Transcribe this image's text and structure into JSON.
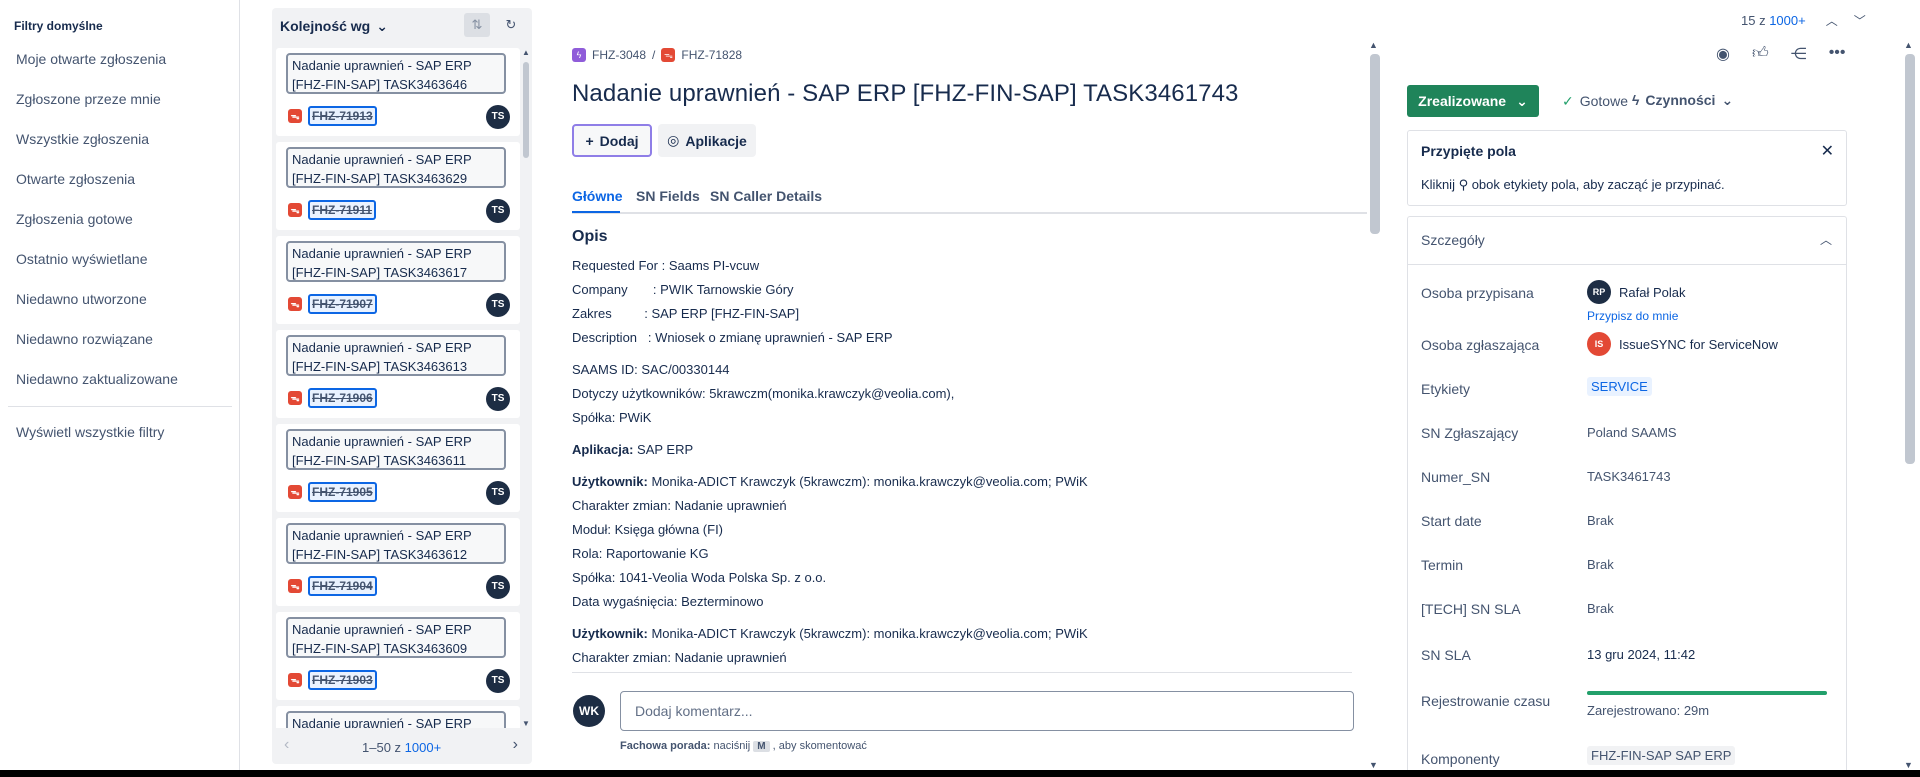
{
  "sidebar": {
    "heading": "Filtry domyślne",
    "items": [
      "Moje otwarte zgłoszenia",
      "Zgłoszone przeze mnie",
      "Wszystkie zgłoszenia",
      "Otwarte zgłoszenia",
      "Zgłoszenia gotowe",
      "Ostatnio wyświetlane",
      "Niedawno utworzone",
      "Niedawno rozwiązane",
      "Niedawno zaktualizowane"
    ],
    "view_all": "Wyświetl wszystkie filtry"
  },
  "list": {
    "sort_label": "Kolejność wg",
    "cards": [
      {
        "title": "Nadanie uprawnień - SAP ERP [FHZ-FIN-SAP] TASK3463646",
        "key": "FHZ-71913",
        "assignee": "TS"
      },
      {
        "title": "Nadanie uprawnień - SAP ERP [FHZ-FIN-SAP] TASK3463629",
        "key": "FHZ-71911",
        "assignee": "TS"
      },
      {
        "title": "Nadanie uprawnień - SAP ERP [FHZ-FIN-SAP] TASK3463617",
        "key": "FHZ-71907",
        "assignee": "TS"
      },
      {
        "title": "Nadanie uprawnień - SAP ERP [FHZ-FIN-SAP] TASK3463613",
        "key": "FHZ-71906",
        "assignee": "TS"
      },
      {
        "title": "Nadanie uprawnień - SAP ERP [FHZ-FIN-SAP] TASK3463611",
        "key": "FHZ-71905",
        "assignee": "TS"
      },
      {
        "title": "Nadanie uprawnień - SAP ERP [FHZ-FIN-SAP] TASK3463612",
        "key": "FHZ-71904",
        "assignee": "TS"
      },
      {
        "title": "Nadanie uprawnień - SAP ERP [FHZ-FIN-SAP] TASK3463609",
        "key": "FHZ-71903",
        "assignee": "TS"
      },
      {
        "title": "Nadanie uprawnień - SAP ERP",
        "key": "",
        "assignee": ""
      }
    ],
    "pager": {
      "range": "1–50 z",
      "total": "1000+"
    }
  },
  "topnav": {
    "count_prefix": "15 z",
    "count_total": "1000+"
  },
  "issue": {
    "parent_key": "FHZ-3048",
    "key": "FHZ-71828",
    "title": "Nadanie uprawnień - SAP ERP [FHZ-FIN-SAP] TASK3461743",
    "add_label": "Dodaj",
    "apps_label": "Aplikacje",
    "tabs": [
      "Główne",
      "SN Fields",
      "SN Caller Details"
    ],
    "desc_heading": "Opis",
    "desc_lines": [
      "Requested For : Saams PI-vcuw",
      "Company       : PWIK Tarnowskie Góry",
      "Zakres         : SAP ERP [FHZ-FIN-SAP]",
      "Description   : Wniosek o zmianę uprawnień - SAP ERP"
    ],
    "saams_lines": [
      "SAAMS ID: SAC/00330144",
      "Dotyczy użytkowników: 5krawczm(monika.krawczyk@veolia.com),",
      "Spółka: PWiK"
    ],
    "app_label": "Aplikacja:",
    "app_value": " SAP ERP",
    "user_block_1": {
      "label": "Użytkownik:",
      "value": " Monika-ADICT Krawczyk (5krawczm): monika.krawczyk@veolia.com; PWiK",
      "lines": [
        "Charakter zmian: Nadanie uprawnień",
        "Moduł: Księga główna (FI)",
        "Rola: Raportowanie KG",
        "Spółka: 1041-Veolia Woda Polska Sp. z o.o.",
        "Data wygaśnięcia: Bezterminowo"
      ]
    },
    "user_block_2": {
      "label": "Użytkownik:",
      "value": " Monika-ADICT Krawczyk (5krawczm): monika.krawczyk@veolia.com; PWiK",
      "lines": [
        "Charakter zmian: Nadanie uprawnień"
      ]
    },
    "comment": {
      "avatar": "WK",
      "placeholder": "Dodaj komentarz...",
      "tip_bold": "Fachowa porada:",
      "tip_pre": " naciśnij ",
      "tip_key": "M",
      "tip_post": " , aby skomentować"
    }
  },
  "right": {
    "status": "Zrealizowane",
    "done": "Gotowe",
    "ops": "Czynności",
    "pinned": {
      "heading": "Przypięte pola",
      "text": "Kliknij ⚲ obok etykiety pola, aby zacząć je przypinać."
    },
    "details_heading": "Szczegóły",
    "fields": {
      "assignee_label": "Osoba przypisana",
      "assignee_initials": "RP",
      "assignee": "Rafał Polak",
      "assign_me": "Przypisz do mnie",
      "reporter_label": "Osoba zgłaszająca",
      "reporter_initials": "IS",
      "reporter": "IssueSYNC for ServiceNow",
      "labels_label": "Etykiety",
      "labels": "SERVICE",
      "sn_reporter_label": "SN Zgłaszający",
      "sn_reporter": "Poland SAAMS",
      "sn_number_label": "Numer_SN",
      "sn_number": "TASK3461743",
      "start_label": "Start date",
      "start": "Brak",
      "term_label": "Termin",
      "term": "Brak",
      "tech_sla_label": "[TECH] SN SLA",
      "tech_sla": "Brak",
      "sn_sla_label": "SN SLA",
      "sn_sla": "13 gru 2024, 11:42",
      "time_label": "Rejestrowanie czasu",
      "time_value": "Zarejestrowano: 29m",
      "time_fraction": 1.0,
      "components_label": "Komponenty",
      "components": "FHZ-FIN-SAP SAP ERP"
    }
  },
  "colors": {
    "accent": "#0c66e4",
    "status_green": "#1f845a",
    "bug_red": "#e34935",
    "epic_purple": "#8f5cd9"
  }
}
